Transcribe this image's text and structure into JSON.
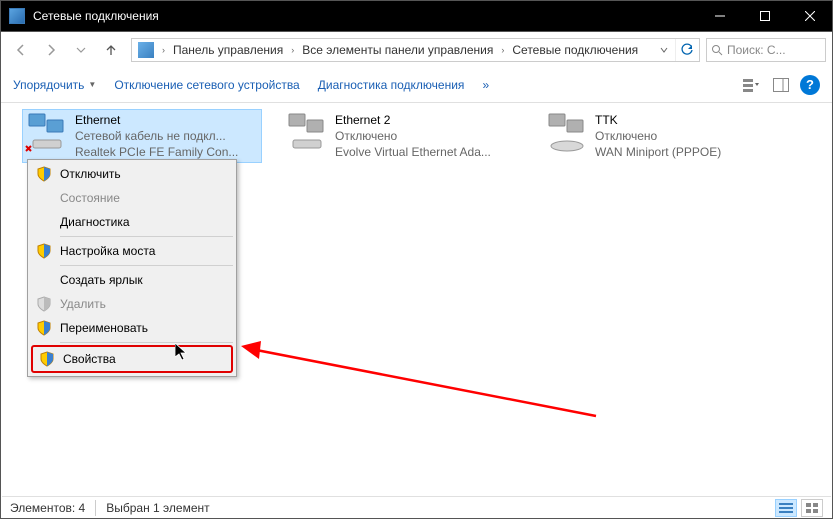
{
  "window": {
    "title": "Сетевые подключения"
  },
  "breadcrumb": {
    "items": [
      "Панель управления",
      "Все элементы панели управления",
      "Сетевые подключения"
    ]
  },
  "search": {
    "placeholder": "Поиск: С..."
  },
  "toolbar": {
    "organize": "Упорядочить",
    "disable": "Отключение сетевого устройства",
    "diagnose": "Диагностика подключения",
    "more": "»"
  },
  "adapters": [
    {
      "name": "Ethernet",
      "status": "Сетевой кабель не подкл...",
      "device": "Realtek PCIe FE Family Con...",
      "selected": true,
      "error": true
    },
    {
      "name": "Ethernet 2",
      "status": "Отключено",
      "device": "Evolve Virtual Ethernet Ada...",
      "selected": false,
      "error": false
    },
    {
      "name": "TTK",
      "status": "Отключено",
      "device": "WAN Miniport (PPPOE)",
      "selected": false,
      "error": false
    }
  ],
  "context_menu": {
    "items": [
      {
        "label": "Отключить",
        "shield": true,
        "enabled": true
      },
      {
        "label": "Состояние",
        "shield": false,
        "enabled": false
      },
      {
        "label": "Диагностика",
        "shield": false,
        "enabled": true
      },
      {
        "separator": true
      },
      {
        "label": "Настройка моста",
        "shield": true,
        "enabled": true
      },
      {
        "separator": true
      },
      {
        "label": "Создать ярлык",
        "shield": false,
        "enabled": true
      },
      {
        "label": "Удалить",
        "shield": true,
        "enabled": false
      },
      {
        "label": "Переименовать",
        "shield": true,
        "enabled": true
      },
      {
        "separator": true
      },
      {
        "label": "Свойства",
        "shield": true,
        "enabled": true,
        "highlight": true
      }
    ]
  },
  "status": {
    "count_label": "Элементов: 4",
    "selected_label": "Выбран 1 элемент"
  }
}
